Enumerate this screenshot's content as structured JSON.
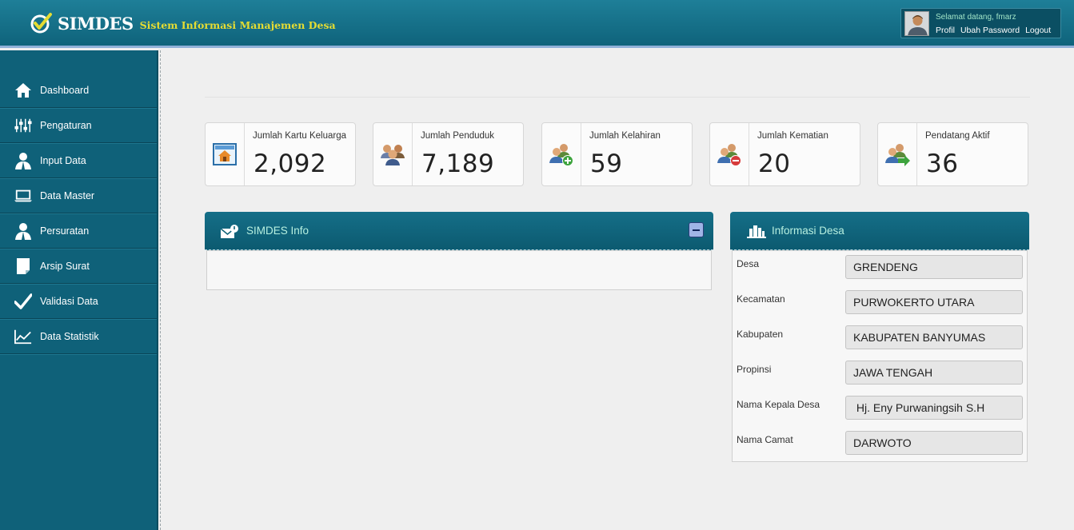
{
  "header": {
    "app_title": "SIMDES",
    "app_subtitle": "Sistem Informasi Manajemen Desa",
    "welcome": "Selamat datang, fmarz",
    "links": [
      "Profil",
      "Ubah Password",
      "Logout"
    ]
  },
  "sidebar": {
    "items": [
      {
        "label": "Dashboard",
        "icon": "home-icon"
      },
      {
        "label": "Pengaturan",
        "icon": "sliders-icon"
      },
      {
        "label": "Input Data",
        "icon": "user-icon"
      },
      {
        "label": "Data Master",
        "icon": "laptop-icon"
      },
      {
        "label": "Persuratan",
        "icon": "user-icon"
      },
      {
        "label": "Arsip Surat",
        "icon": "document-icon"
      },
      {
        "label": "Validasi Data",
        "icon": "check-icon"
      },
      {
        "label": "Data Statistik",
        "icon": "chart-icon"
      }
    ]
  },
  "stats": [
    {
      "label": "Jumlah Kartu Keluarga",
      "value": "2,092",
      "icon": "house-card-icon"
    },
    {
      "label": "Jumlah Penduduk",
      "value": "7,189",
      "icon": "people-group-icon"
    },
    {
      "label": "Jumlah Kelahiran",
      "value": "59",
      "icon": "people-add-icon"
    },
    {
      "label": "Jumlah Kematian",
      "value": "20",
      "icon": "people-remove-icon"
    },
    {
      "label": "Pendatang Aktif",
      "value": "36",
      "icon": "people-arrow-icon"
    }
  ],
  "info_panel": {
    "title": "SIMDES Info"
  },
  "desa_panel": {
    "title": "Informasi Desa",
    "rows": [
      {
        "label": "Desa",
        "value": "GRENDENG"
      },
      {
        "label": "Kecamatan",
        "value": "PURWOKERTO UTARA"
      },
      {
        "label": "Kabupaten",
        "value": "KABUPATEN BANYUMAS"
      },
      {
        "label": "Propinsi",
        "value": "JAWA TENGAH"
      },
      {
        "label": "Nama Kepala Desa",
        "value": " Hj. Eny Purwaningsih S.H"
      },
      {
        "label": "Nama Camat",
        "value": "DARWOTO"
      }
    ]
  },
  "colors": {
    "header": "#13718a",
    "sidebar": "#0f6179",
    "panel_head": "#0f6379",
    "accent_text": "#b7f0e0",
    "logo_sub": "#e4dc33"
  }
}
